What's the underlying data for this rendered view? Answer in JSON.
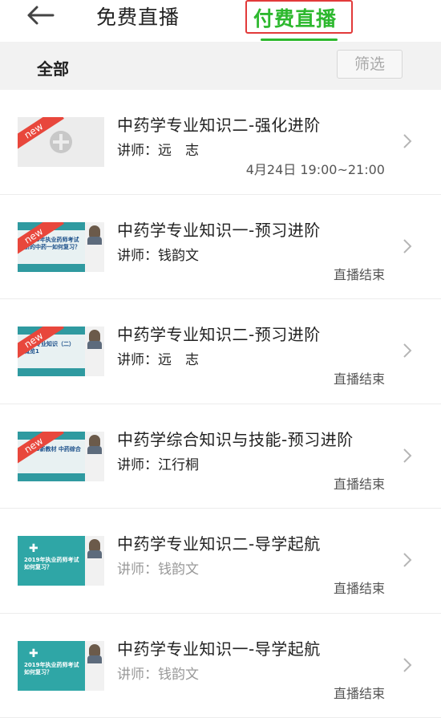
{
  "header": {
    "tabs": [
      {
        "label": "免费直播",
        "active": false
      },
      {
        "label": "付费直播",
        "active": true
      }
    ]
  },
  "filter": {
    "all_label": "全部",
    "filter_button": "筛选"
  },
  "courses": [
    {
      "title": "中药学专业知识二-强化进阶",
      "teacher": "讲师：远　志",
      "status": "4月24日 19:00~21:00",
      "thumb": "plain",
      "is_new": true,
      "slide_text": ""
    },
    {
      "title": "中药学专业知识一-预习进阶",
      "teacher": "讲师：钱韵文",
      "status": "直播结束",
      "thumb": "slide",
      "is_new": true,
      "slide_text": "2020年执业药师考试 新的中药一如何复习？"
    },
    {
      "title": "中药学专业知识二-预习进阶",
      "teacher": "讲师：远　志",
      "status": "直播结束",
      "thumb": "slide",
      "is_new": true,
      "slide_text": "药学专业知识（二） 概览1"
    },
    {
      "title": "中药学综合知识与技能-预习进阶",
      "teacher": "讲师：江行桐",
      "status": "直播结束",
      "thumb": "slide",
      "is_new": true,
      "slide_text": "2020新教材 中药综合"
    },
    {
      "title": "中药学专业知识二-导学起航",
      "teacher": "讲师：钱韵文",
      "status": "直播结束",
      "thumb": "teal",
      "is_new": false,
      "slide_text": "2019年执业药师考试 如何复习？"
    },
    {
      "title": "中药学专业知识一-导学起航",
      "teacher": "讲师：钱韵文",
      "status": "直播结束",
      "thumb": "teal",
      "is_new": false,
      "slide_text": "2019年执业药师考试 如何复习？"
    }
  ],
  "ribbon_label": "new",
  "colors": {
    "accent_green": "#2db82e",
    "highlight_red": "#e23a3a",
    "ribbon_red": "#e8473c"
  }
}
